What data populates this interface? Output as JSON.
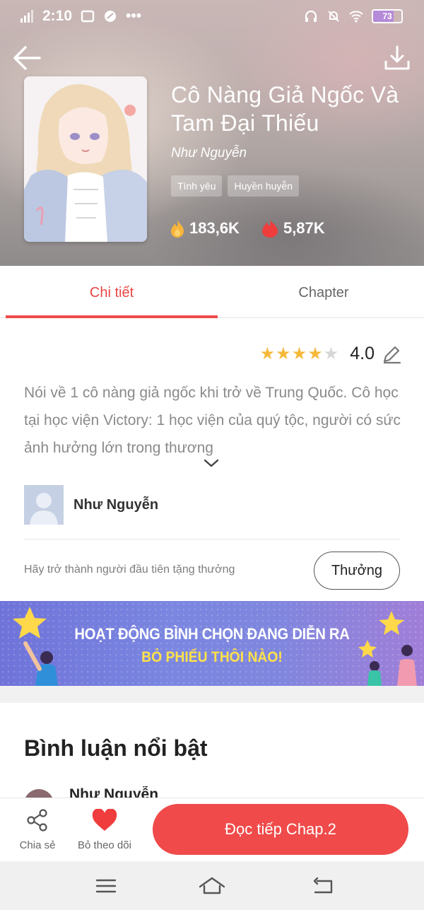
{
  "status_bar": {
    "time": "2:10",
    "dots": "•••",
    "battery": "73"
  },
  "book": {
    "title": "Cô Nàng Giả Ngốc Và Tam Đại Thiếu",
    "author": "Như Nguyễn",
    "tags": [
      "Tình yêu",
      "Huyền huyễn"
    ],
    "views": "183,6K",
    "likes": "5,87K"
  },
  "tabs": {
    "detail": "Chi tiết",
    "chapter": "Chapter",
    "active": "detail"
  },
  "rating": {
    "value_label": "4.0",
    "value": 4.0,
    "max": 5
  },
  "description": "Nói về 1 cô nàng giả ngốc khi trở về Trung Quốc. Cô học tại học viện Victory: 1 học viện của quý tộc, người có sức ảnh hưởng lớn trong thương",
  "author_card": {
    "name": "Như Nguyễn"
  },
  "reward": {
    "text": "Hãy trở thành người đầu tiên tặng thưởng",
    "button": "Thưởng"
  },
  "banner": {
    "line1": "HOẠT ĐỘNG BÌNH CHỌN ĐANG DIỄN RA",
    "line2": "BỎ PHIẾU THÔI NÀO!"
  },
  "comments": {
    "title": "Bình luận nổi bật",
    "first_name": "Như Nguyễn"
  },
  "bottom_bar": {
    "share": "Chia sẻ",
    "unfollow": "Bỏ theo dõi",
    "read": "Đọc tiếp Chap.2"
  },
  "colors": {
    "accent": "#ef4a4a",
    "star": "#f6b93b",
    "star_empty": "#d6d6d6",
    "banner_yellow": "#ffe14a"
  },
  "icons": {
    "back": "arrow-left-icon",
    "download": "download-icon",
    "views": "fire-icon",
    "likes": "flame-icon",
    "edit": "pencil-icon",
    "expand": "chevron-down-icon",
    "share": "share-icon",
    "unfollow": "heart-icon"
  }
}
